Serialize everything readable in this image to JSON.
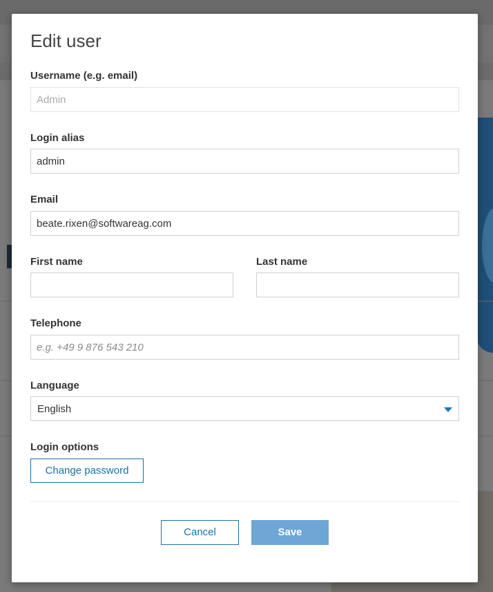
{
  "dialog": {
    "title": "Edit user"
  },
  "fields": {
    "username": {
      "label": "Username (e.g. email)",
      "placeholder": "Admin",
      "value": ""
    },
    "login_alias": {
      "label": "Login alias",
      "value": "admin"
    },
    "email": {
      "label": "Email",
      "value": "beate.rixen@softwareag.com"
    },
    "first_name": {
      "label": "First name",
      "value": ""
    },
    "last_name": {
      "label": "Last name",
      "value": ""
    },
    "telephone": {
      "label": "Telephone",
      "placeholder": "e.g. +49 9 876 543 210",
      "value": ""
    },
    "language": {
      "label": "Language",
      "selected": "English"
    }
  },
  "login_options": {
    "label": "Login options",
    "change_password_label": "Change password"
  },
  "actions": {
    "cancel_label": "Cancel",
    "save_label": "Save"
  },
  "colors": {
    "accent": "#1a6fa8",
    "primary_button": "#6ea6d6",
    "overlay": "#7b7b7b"
  }
}
